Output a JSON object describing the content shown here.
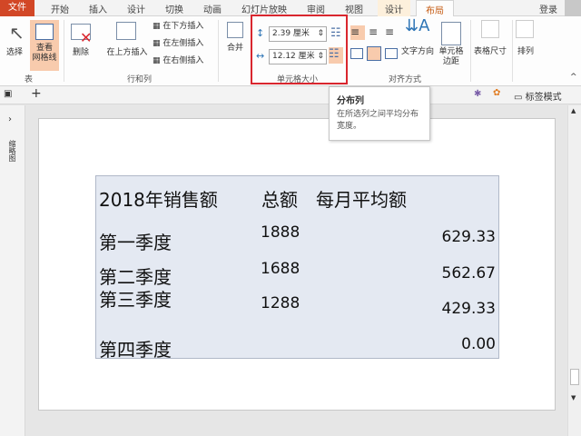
{
  "tabs": {
    "file": "文件",
    "items": [
      "开始",
      "插入",
      "设计",
      "切换",
      "动画",
      "幻灯片放映",
      "审阅",
      "视图",
      "设计",
      "布局"
    ],
    "login": "登录"
  },
  "ribbon": {
    "select": "选择",
    "view_gridlines": "查看\n网格线",
    "delete": "删除",
    "insert_above": "在上方插入",
    "insert_below": "在下方插入",
    "insert_left": "在左侧插入",
    "insert_right": "在右侧插入",
    "merge": "合并",
    "height_value": "2.39 厘米",
    "width_value": "12.12 厘米",
    "text_direction": "文字方向",
    "cell_margins": "单元格\n边距",
    "table_size": "表格尺寸",
    "arrange": "排列",
    "groups": {
      "table": "表",
      "rows_cols": "行和列",
      "cell_size": "单元格大小",
      "alignment": "对齐方式"
    }
  },
  "toolbar": {
    "tag_mode": "标签模式"
  },
  "tooltip": {
    "title": "分布列",
    "body": "在所选列之间平均分布宽度。"
  },
  "side_panel": {
    "label": "缩略图"
  },
  "table": {
    "headers": [
      "2018年销售额",
      "总额",
      "每月平均额"
    ],
    "rows": [
      [
        "第一季度",
        "1888",
        "629.33"
      ],
      [
        "第二季度",
        "1688",
        "562.67"
      ],
      [
        "第三季度",
        "1288",
        "429.33"
      ],
      [
        "第四季度",
        "",
        "0.00"
      ]
    ]
  },
  "colors": {
    "file_tab": "#d24726",
    "highlight_box": "#d9262e",
    "active_button": "#f8cbad"
  }
}
